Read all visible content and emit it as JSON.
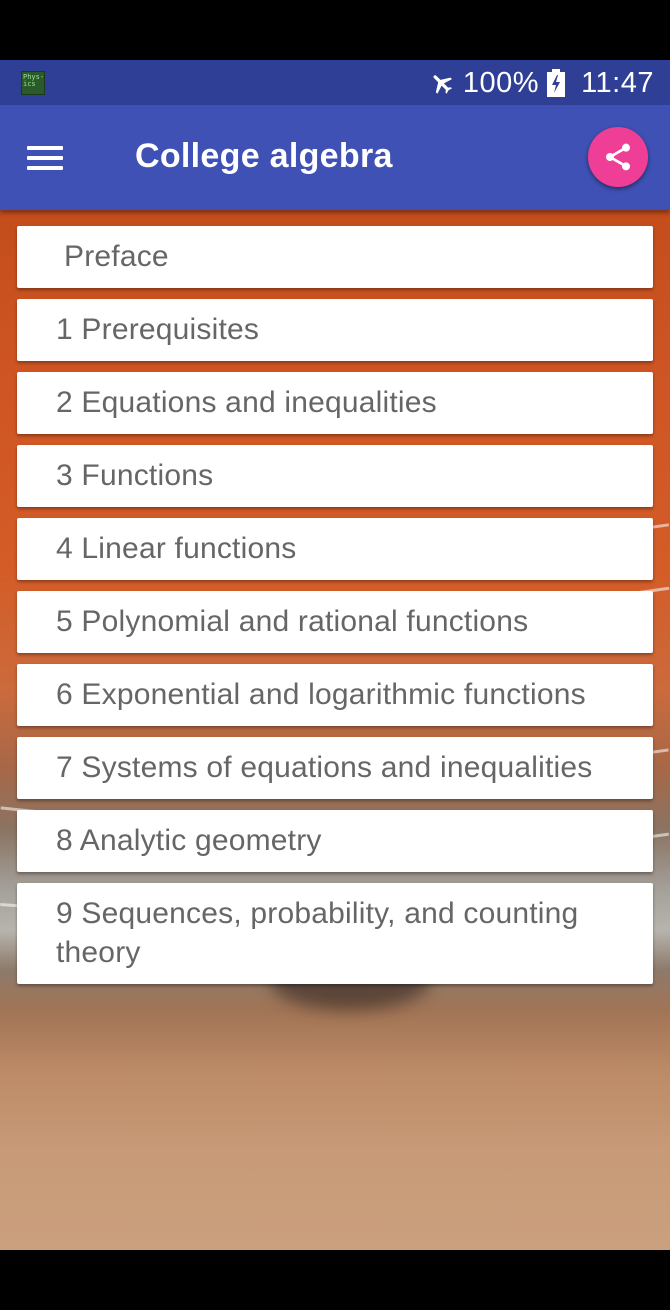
{
  "status_bar": {
    "app_thumb_text": "Phys-ics",
    "battery_percent": "100%",
    "time": "11:47"
  },
  "app_bar": {
    "title": "College algebra",
    "menu_icon": "hamburger-menu-icon",
    "share_icon": "share-icon"
  },
  "colors": {
    "status_bar": "#2f3f96",
    "app_bar": "#3f51b5",
    "share_button": "#ef3e96",
    "card": "#ffffff",
    "card_text": "#666666"
  },
  "chapters": [
    {
      "label": "Preface"
    },
    {
      "label": "1 Prerequisites"
    },
    {
      "label": "2 Equations and inequalities"
    },
    {
      "label": "3 Functions"
    },
    {
      "label": "4 Linear functions"
    },
    {
      "label": "5 Polynomial and rational functions"
    },
    {
      "label": "6 Exponential and logarithmic functions"
    },
    {
      "label": "7 Systems of equations and inequalities"
    },
    {
      "label": "8 Analytic geometry"
    },
    {
      "label": "9 Sequences, probability, and counting theory"
    }
  ]
}
